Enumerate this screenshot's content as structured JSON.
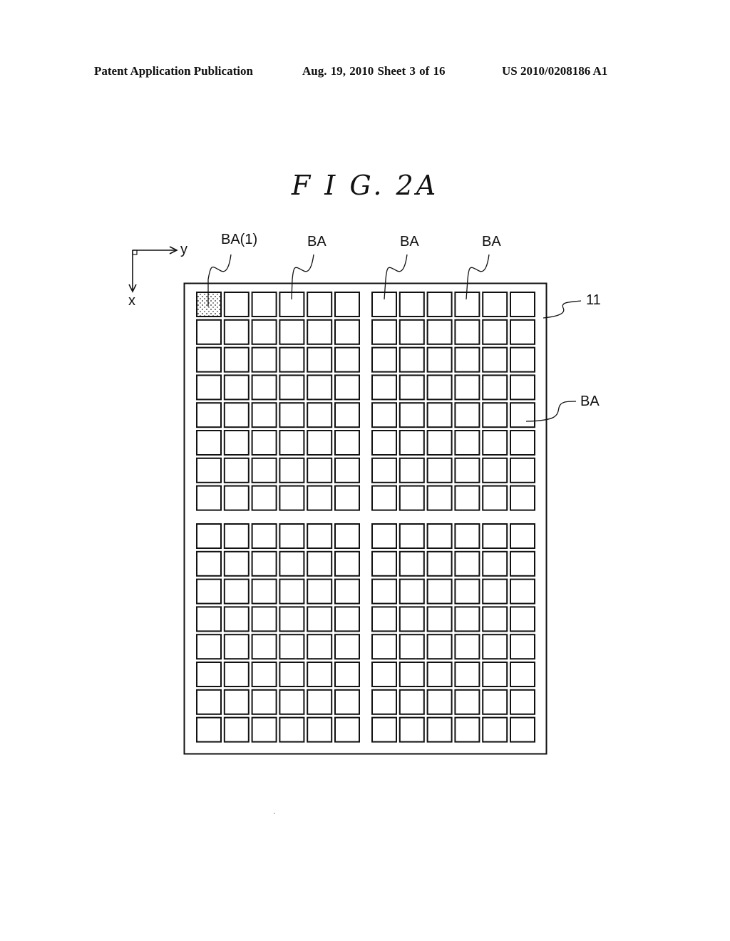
{
  "header": {
    "publication": "Patent Application Publication",
    "date_sheet": "Aug. 19, 2010  Sheet 3 of 16",
    "patent_number": "US 2010/0208186 A1"
  },
  "figure": {
    "title": "F I G. 2A",
    "axes": {
      "x_label": "x",
      "y_label": "y"
    },
    "reference_numeral": "11",
    "labels": {
      "first_block": "BA(1)",
      "block": "BA"
    },
    "grid": {
      "rows": 16,
      "columns": 12,
      "row_groups": 2,
      "column_groups": 2,
      "highlighted_cell": {
        "row": 1,
        "column": 1,
        "pattern": "dotted"
      }
    }
  }
}
